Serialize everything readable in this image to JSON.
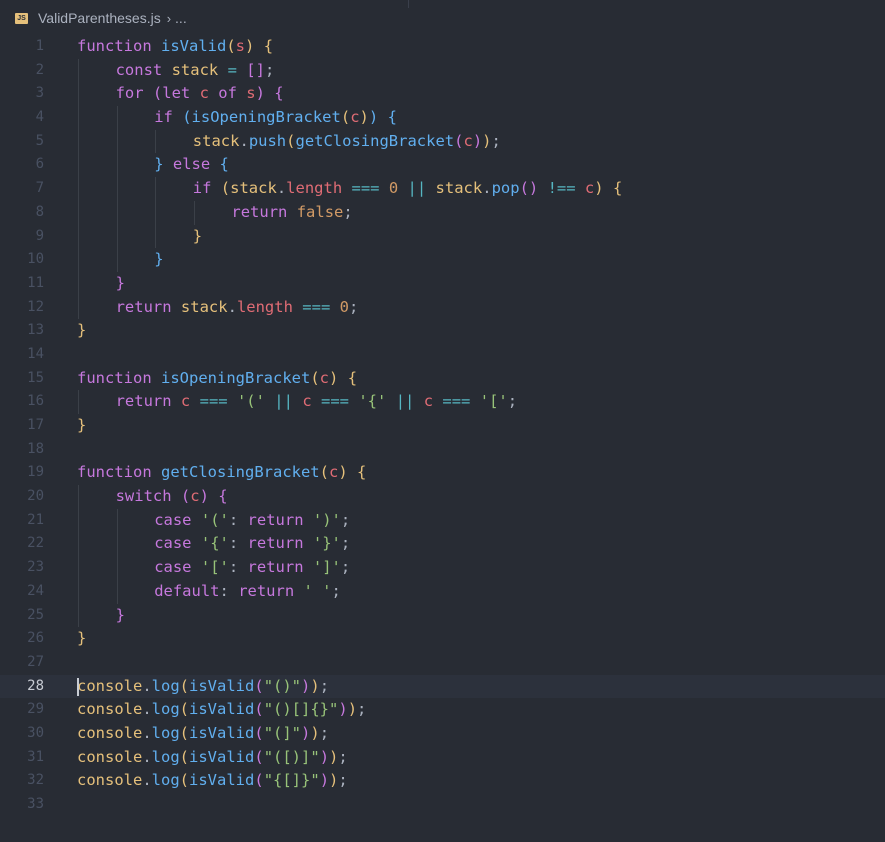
{
  "breadcrumb": {
    "file_icon": "JS",
    "file_name": "ValidParentheses.js",
    "chevron": "›",
    "more": "..."
  },
  "editor": {
    "current_line": 28,
    "lines": [
      {
        "num": "1",
        "guides": 0,
        "t": [
          [
            "kw",
            "function "
          ],
          [
            "fn",
            "isValid"
          ],
          [
            "b1",
            "("
          ],
          [
            "pa",
            "s"
          ],
          [
            "b1",
            ")"
          ],
          [
            "tx",
            " "
          ],
          [
            "b1",
            "{"
          ]
        ]
      },
      {
        "num": "2",
        "guides": 1,
        "t": [
          [
            "kw",
            "const "
          ],
          [
            "va",
            "stack"
          ],
          [
            "tx",
            " "
          ],
          [
            "op",
            "="
          ],
          [
            "tx",
            " "
          ],
          [
            "b2",
            "[]"
          ],
          [
            "tx",
            ";"
          ]
        ]
      },
      {
        "num": "3",
        "guides": 1,
        "t": [
          [
            "kw",
            "for "
          ],
          [
            "b2",
            "("
          ],
          [
            "kw",
            "let "
          ],
          [
            "pa",
            "c"
          ],
          [
            "kw",
            " of "
          ],
          [
            "pa",
            "s"
          ],
          [
            "b2",
            ")"
          ],
          [
            "tx",
            " "
          ],
          [
            "b2",
            "{"
          ]
        ]
      },
      {
        "num": "4",
        "guides": 2,
        "t": [
          [
            "kw",
            "if "
          ],
          [
            "b3",
            "("
          ],
          [
            "fn",
            "isOpeningBracket"
          ],
          [
            "b1",
            "("
          ],
          [
            "pa",
            "c"
          ],
          [
            "b1",
            ")"
          ],
          [
            "b3",
            ")"
          ],
          [
            "tx",
            " "
          ],
          [
            "b3",
            "{"
          ]
        ]
      },
      {
        "num": "5",
        "guides": 3,
        "t": [
          [
            "va",
            "stack"
          ],
          [
            "tx",
            "."
          ],
          [
            "fn",
            "push"
          ],
          [
            "b1",
            "("
          ],
          [
            "fn",
            "getClosingBracket"
          ],
          [
            "b2",
            "("
          ],
          [
            "pa",
            "c"
          ],
          [
            "b2",
            ")"
          ],
          [
            "b1",
            ")"
          ],
          [
            "tx",
            ";"
          ]
        ]
      },
      {
        "num": "6",
        "guides": 2,
        "t": [
          [
            "b3",
            "}"
          ],
          [
            "kw",
            " else "
          ],
          [
            "b3",
            "{"
          ]
        ]
      },
      {
        "num": "7",
        "guides": 3,
        "t": [
          [
            "kw",
            "if "
          ],
          [
            "b1",
            "("
          ],
          [
            "va",
            "stack"
          ],
          [
            "tx",
            "."
          ],
          [
            "pa",
            "length"
          ],
          [
            "tx",
            " "
          ],
          [
            "op",
            "==="
          ],
          [
            "tx",
            " "
          ],
          [
            "nu",
            "0"
          ],
          [
            "tx",
            " "
          ],
          [
            "op",
            "||"
          ],
          [
            "tx",
            " "
          ],
          [
            "va",
            "stack"
          ],
          [
            "tx",
            "."
          ],
          [
            "fn",
            "pop"
          ],
          [
            "b2",
            "()"
          ],
          [
            "tx",
            " "
          ],
          [
            "op",
            "!=="
          ],
          [
            "tx",
            " "
          ],
          [
            "pa",
            "c"
          ],
          [
            "b1",
            ")"
          ],
          [
            "tx",
            " "
          ],
          [
            "b1",
            "{"
          ]
        ]
      },
      {
        "num": "8",
        "guides": 4,
        "t": [
          [
            "kw",
            "return "
          ],
          [
            "nu",
            "false"
          ],
          [
            "tx",
            ";"
          ]
        ]
      },
      {
        "num": "9",
        "guides": 3,
        "t": [
          [
            "b1",
            "}"
          ]
        ]
      },
      {
        "num": "10",
        "guides": 2,
        "t": [
          [
            "b3",
            "}"
          ]
        ]
      },
      {
        "num": "11",
        "guides": 1,
        "t": [
          [
            "b2",
            "}"
          ]
        ]
      },
      {
        "num": "12",
        "guides": 1,
        "t": [
          [
            "kw",
            "return "
          ],
          [
            "va",
            "stack"
          ],
          [
            "tx",
            "."
          ],
          [
            "pa",
            "length"
          ],
          [
            "tx",
            " "
          ],
          [
            "op",
            "==="
          ],
          [
            "tx",
            " "
          ],
          [
            "nu",
            "0"
          ],
          [
            "tx",
            ";"
          ]
        ]
      },
      {
        "num": "13",
        "guides": 0,
        "t": [
          [
            "b1",
            "}"
          ]
        ]
      },
      {
        "num": "14",
        "guides": 0,
        "t": []
      },
      {
        "num": "15",
        "guides": 0,
        "t": [
          [
            "kw",
            "function "
          ],
          [
            "fn",
            "isOpeningBracket"
          ],
          [
            "b1",
            "("
          ],
          [
            "pa",
            "c"
          ],
          [
            "b1",
            ")"
          ],
          [
            "tx",
            " "
          ],
          [
            "b1",
            "{"
          ]
        ]
      },
      {
        "num": "16",
        "guides": 1,
        "t": [
          [
            "kw",
            "return "
          ],
          [
            "pa",
            "c"
          ],
          [
            "tx",
            " "
          ],
          [
            "op",
            "==="
          ],
          [
            "tx",
            " "
          ],
          [
            "st",
            "'('"
          ],
          [
            "tx",
            " "
          ],
          [
            "op",
            "||"
          ],
          [
            "tx",
            " "
          ],
          [
            "pa",
            "c"
          ],
          [
            "tx",
            " "
          ],
          [
            "op",
            "==="
          ],
          [
            "tx",
            " "
          ],
          [
            "st",
            "'{'"
          ],
          [
            "tx",
            " "
          ],
          [
            "op",
            "||"
          ],
          [
            "tx",
            " "
          ],
          [
            "pa",
            "c"
          ],
          [
            "tx",
            " "
          ],
          [
            "op",
            "==="
          ],
          [
            "tx",
            " "
          ],
          [
            "st",
            "'['"
          ],
          [
            "tx",
            ";"
          ]
        ]
      },
      {
        "num": "17",
        "guides": 0,
        "t": [
          [
            "b1",
            "}"
          ]
        ]
      },
      {
        "num": "18",
        "guides": 0,
        "t": []
      },
      {
        "num": "19",
        "guides": 0,
        "t": [
          [
            "kw",
            "function "
          ],
          [
            "fn",
            "getClosingBracket"
          ],
          [
            "b1",
            "("
          ],
          [
            "pa",
            "c"
          ],
          [
            "b1",
            ")"
          ],
          [
            "tx",
            " "
          ],
          [
            "b1",
            "{"
          ]
        ]
      },
      {
        "num": "20",
        "guides": 1,
        "t": [
          [
            "kw",
            "switch "
          ],
          [
            "b2",
            "("
          ],
          [
            "pa",
            "c"
          ],
          [
            "b2",
            ")"
          ],
          [
            "tx",
            " "
          ],
          [
            "b2",
            "{"
          ]
        ]
      },
      {
        "num": "21",
        "guides": 2,
        "t": [
          [
            "kw",
            "case "
          ],
          [
            "st",
            "'('"
          ],
          [
            "tx",
            ": "
          ],
          [
            "kw",
            "return "
          ],
          [
            "st",
            "')'"
          ],
          [
            "tx",
            ";"
          ]
        ]
      },
      {
        "num": "22",
        "guides": 2,
        "t": [
          [
            "kw",
            "case "
          ],
          [
            "st",
            "'{'"
          ],
          [
            "tx",
            ": "
          ],
          [
            "kw",
            "return "
          ],
          [
            "st",
            "'}'"
          ],
          [
            "tx",
            ";"
          ]
        ]
      },
      {
        "num": "23",
        "guides": 2,
        "t": [
          [
            "kw",
            "case "
          ],
          [
            "st",
            "'['"
          ],
          [
            "tx",
            ": "
          ],
          [
            "kw",
            "return "
          ],
          [
            "st",
            "']'"
          ],
          [
            "tx",
            ";"
          ]
        ]
      },
      {
        "num": "24",
        "guides": 2,
        "t": [
          [
            "kw",
            "default"
          ],
          [
            "tx",
            ": "
          ],
          [
            "kw",
            "return "
          ],
          [
            "st",
            "' '"
          ],
          [
            "tx",
            ";"
          ]
        ]
      },
      {
        "num": "25",
        "guides": 1,
        "t": [
          [
            "b2",
            "}"
          ]
        ]
      },
      {
        "num": "26",
        "guides": 0,
        "t": [
          [
            "b1",
            "}"
          ]
        ]
      },
      {
        "num": "27",
        "guides": 0,
        "t": []
      },
      {
        "num": "28",
        "guides": 0,
        "t": [
          [
            "va",
            "console"
          ],
          [
            "tx",
            "."
          ],
          [
            "fn",
            "log"
          ],
          [
            "b1",
            "("
          ],
          [
            "fn",
            "isValid"
          ],
          [
            "b2",
            "("
          ],
          [
            "st",
            "\"()\""
          ],
          [
            "b2",
            ")"
          ],
          [
            "b1",
            ")"
          ],
          [
            "tx",
            ";"
          ]
        ]
      },
      {
        "num": "29",
        "guides": 0,
        "t": [
          [
            "va",
            "console"
          ],
          [
            "tx",
            "."
          ],
          [
            "fn",
            "log"
          ],
          [
            "b1",
            "("
          ],
          [
            "fn",
            "isValid"
          ],
          [
            "b2",
            "("
          ],
          [
            "st",
            "\"()[]{}\""
          ],
          [
            "b2",
            ")"
          ],
          [
            "b1",
            ")"
          ],
          [
            "tx",
            ";"
          ]
        ]
      },
      {
        "num": "30",
        "guides": 0,
        "t": [
          [
            "va",
            "console"
          ],
          [
            "tx",
            "."
          ],
          [
            "fn",
            "log"
          ],
          [
            "b1",
            "("
          ],
          [
            "fn",
            "isValid"
          ],
          [
            "b2",
            "("
          ],
          [
            "st",
            "\"(]\""
          ],
          [
            "b2",
            ")"
          ],
          [
            "b1",
            ")"
          ],
          [
            "tx",
            ";"
          ]
        ]
      },
      {
        "num": "31",
        "guides": 0,
        "t": [
          [
            "va",
            "console"
          ],
          [
            "tx",
            "."
          ],
          [
            "fn",
            "log"
          ],
          [
            "b1",
            "("
          ],
          [
            "fn",
            "isValid"
          ],
          [
            "b2",
            "("
          ],
          [
            "st",
            "\"([)]\""
          ],
          [
            "b2",
            ")"
          ],
          [
            "b1",
            ")"
          ],
          [
            "tx",
            ";"
          ]
        ]
      },
      {
        "num": "32",
        "guides": 0,
        "t": [
          [
            "va",
            "console"
          ],
          [
            "tx",
            "."
          ],
          [
            "fn",
            "log"
          ],
          [
            "b1",
            "("
          ],
          [
            "fn",
            "isValid"
          ],
          [
            "b2",
            "("
          ],
          [
            "st",
            "\"{[]}\""
          ],
          [
            "b2",
            ")"
          ],
          [
            "b1",
            ")"
          ],
          [
            "tx",
            ";"
          ]
        ]
      },
      {
        "num": "33",
        "guides": 0,
        "t": []
      }
    ]
  }
}
